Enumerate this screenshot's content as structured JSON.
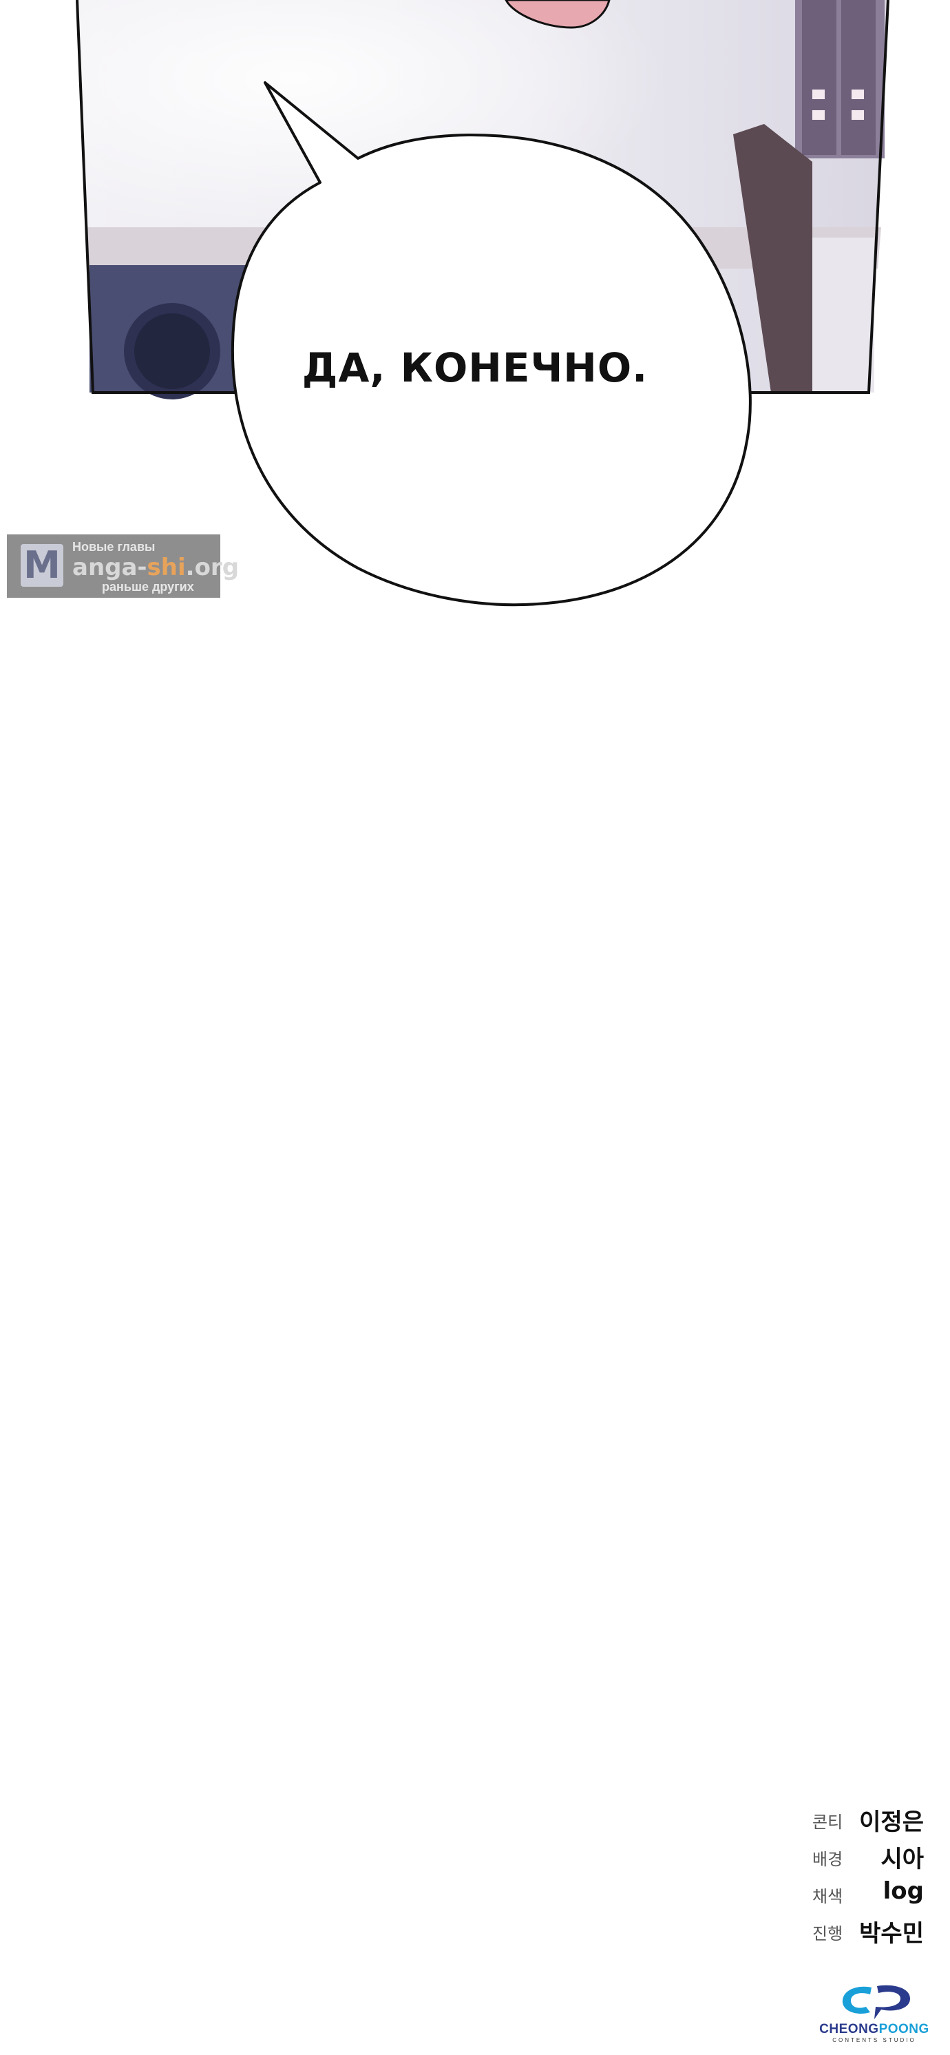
{
  "speech_bubble": {
    "text": "ДА, КОНЕЧНО."
  },
  "watermark": {
    "logo_letter": "M",
    "line_top": "Новые главы",
    "site_prefix": "anga-",
    "site_highlight": "shi",
    "site_suffix": ".org",
    "line_bottom": "раньше других"
  },
  "credits": [
    {
      "role": "콘티",
      "name": "이정은"
    },
    {
      "role": "배경",
      "name": "시아"
    },
    {
      "role": "채색",
      "name": "log"
    },
    {
      "role": "진행",
      "name": "박수민"
    }
  ],
  "studio": {
    "name_part1": "CHEONG",
    "name_part2": "POONG",
    "subtitle": "CONTENTS STUDIO"
  },
  "colors": {
    "panel_wall": "#ebe9f0",
    "panel_floor": "#d8d3dc",
    "panel_cabinet": "#4a4e72",
    "panel_shelf_dark": "#5c4a52",
    "studio_blue": "#2a3a8c",
    "studio_cyan": "#1aa0d8"
  }
}
